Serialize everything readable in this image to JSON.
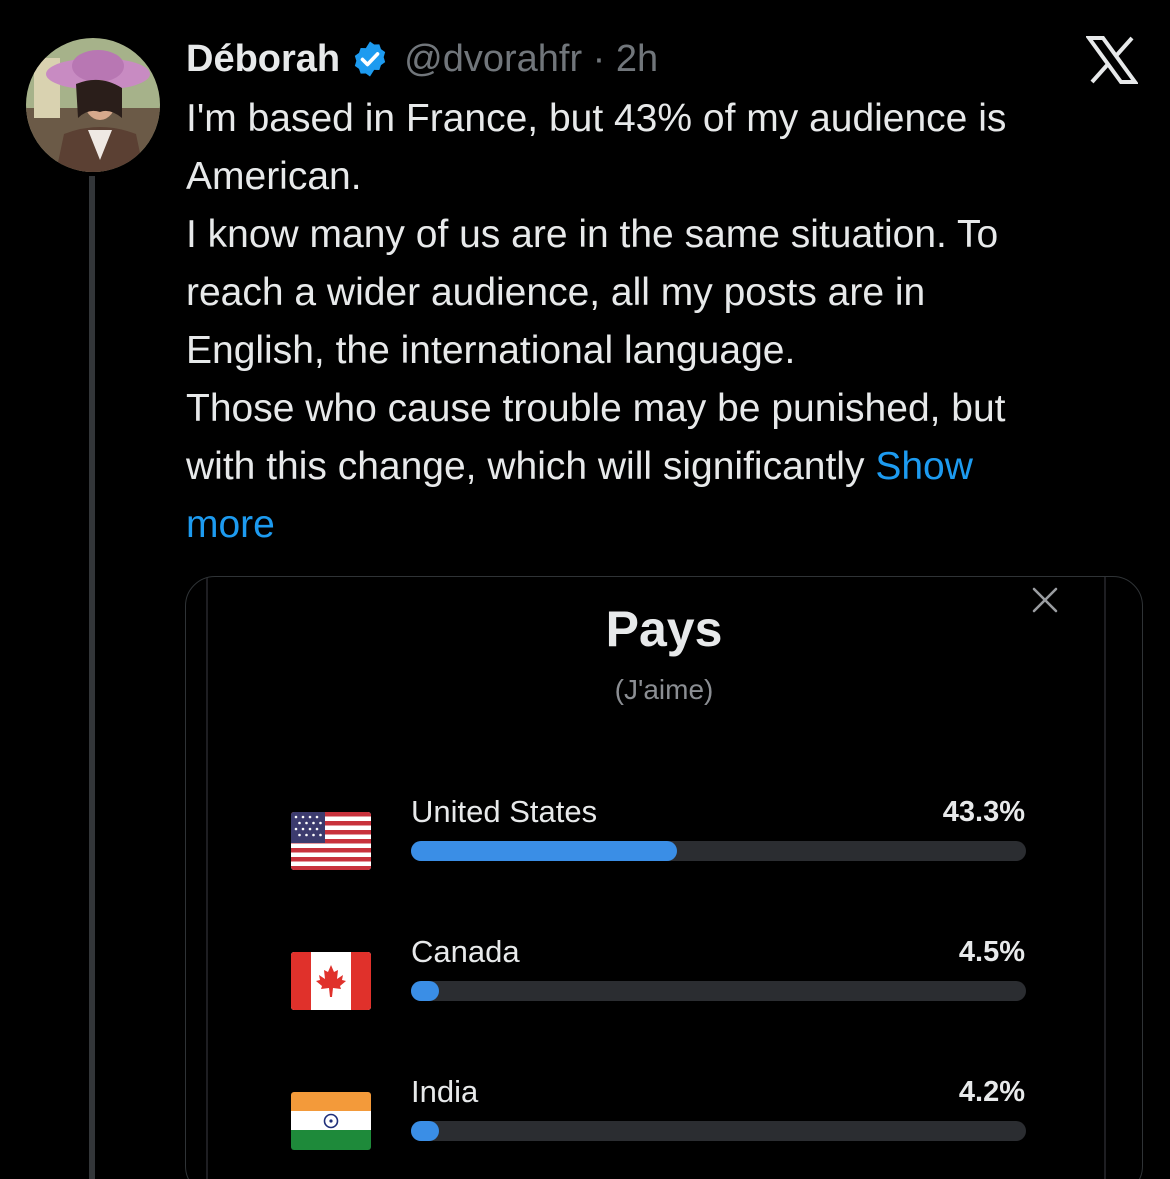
{
  "tweet": {
    "author_name": "Déborah",
    "handle_time": "@dvorahfr · 2h",
    "lines": [
      "I'm based in France, but 43% of my audience is",
      "American.",
      "I know many of us are in the same situation. To",
      "reach a wider audience, all my posts are in",
      "English, the international language.",
      "Those who cause trouble may be punished, but",
      "with this change, which will significantly "
    ],
    "show_more_1": "Show",
    "show_more_2": "more"
  },
  "colors": {
    "background": "#000000",
    "text": "#e7e9ea",
    "secondary_text": "#71767b",
    "link": "#1d9bf0",
    "verified": "#1d9bf0",
    "bar_fill": "#3a8ee6",
    "bar_track": "#2b2d31"
  },
  "icons": [
    "verified-badge-icon",
    "x-logo-icon",
    "close-icon",
    "us-flag-icon",
    "canada-flag-icon",
    "india-flag-icon"
  ],
  "card": {
    "title": "Pays",
    "subtitle": "(J'aime)",
    "rows": [
      {
        "country": "United States",
        "percent_label": "43.3%",
        "value": 43.3
      },
      {
        "country": "Canada",
        "percent_label": "4.5%",
        "value": 4.5
      },
      {
        "country": "India",
        "percent_label": "4.2%",
        "value": 4.2
      }
    ]
  }
}
